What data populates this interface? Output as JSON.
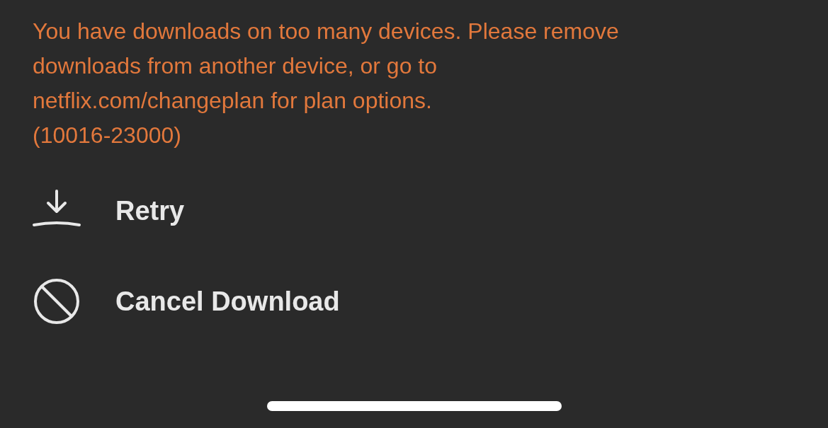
{
  "error": {
    "message": "You have downloads on too many devices. Please remove downloads from another device, or go to netflix.com/changeplan for plan options.",
    "code": "(10016-23000)"
  },
  "actions": [
    {
      "kind": "download",
      "label": "Retry"
    },
    {
      "kind": "cancel",
      "label": "Cancel Download"
    }
  ]
}
